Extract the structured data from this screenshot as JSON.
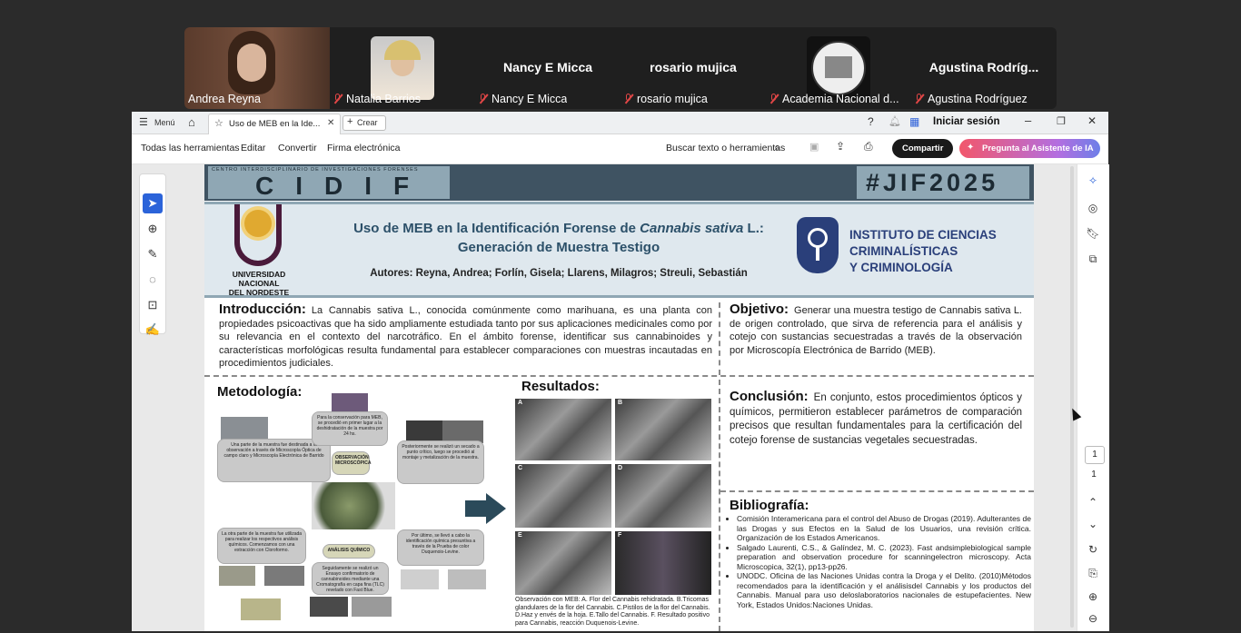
{
  "participants": [
    {
      "name": "Andrea Reyna",
      "big": "",
      "muted": false,
      "video": true
    },
    {
      "name": "Natalia Barrios",
      "big": "",
      "muted": true,
      "video": true
    },
    {
      "name": "Nancy E Micca",
      "big": "Nancy E Micca",
      "muted": true,
      "video": false
    },
    {
      "name": "rosario mujica",
      "big": "rosario mujica",
      "muted": true,
      "video": false
    },
    {
      "name": "Academia Nacional d...",
      "big": "",
      "muted": true,
      "video": false,
      "logo": true
    },
    {
      "name": "Agustina Rodríguez",
      "big": "Agustina  Rodríg...",
      "muted": true,
      "video": false
    }
  ],
  "tabbar": {
    "menu": "Menú",
    "tab_title": "Uso de MEB en la Ide...",
    "create": "Crear",
    "sign_in": "Iniciar sesión"
  },
  "toolbar": {
    "items": [
      "Todas las herramientas",
      "Editar",
      "Convertir",
      "Firma electrónica"
    ],
    "search": "Buscar texto o herramientas",
    "share": "Compartir",
    "ai": "Pregunta al Asistente de IA"
  },
  "pager": {
    "current": "1",
    "total": "1"
  },
  "poster": {
    "banner_left": "CIDIF",
    "banner_left_small": "CENTRO INTERDISCIPLINARIO DE INVESTIGACIONES FORENSES",
    "banner_right": "#JIF2025",
    "title_line1_a": "Uso de MEB en la Identificación Forense de ",
    "title_line1_i": "Cannabis sativa",
    "title_line1_b": " L.:",
    "title_line2": "Generación de Muestra Testigo",
    "authors": "Autores: Reyna, Andrea; Forlín, Gisela; Llarens, Milagros; Streuli, Sebastián",
    "unne": [
      "UNIVERSIDAD",
      "NACIONAL",
      "DEL NORDESTE"
    ],
    "icc": [
      "INSTITUTO DE CIENCIAS",
      "CRIMINALÍSTICAS",
      "Y CRIMINOLOGÍA"
    ],
    "intro_title": "Introducción:",
    "intro_text": "La Cannabis sativa L., conocida comúnmente como marihuana, es una planta con propiedades psicoactivas que ha sido ampliamente estudiada tanto por sus aplicaciones medicinales como por su relevancia en el contexto del narcotráfico. En el ámbito forense, identificar sus cannabinoides y características morfológicas resulta fundamental para establecer comparaciones con muestras incautadas en procedimientos judiciales.",
    "obj_title": "Objetivo:",
    "obj_text": "Generar una muestra testigo de Cannabis sativa L. de origen controlado, que sirva de referencia para el análisis y cotejo con sustancias secuestradas a través de la observación por Microscopía Electrónica de Barrido (MEB).",
    "met_title": "Metodología:",
    "res_title": "Resultados:",
    "flow": {
      "b1": "Una parte de la muestra fue destinada a la observación a través de Microscopía Óptica de campo claro y Microscopía Electrónica de Barrido",
      "b2": "Para la conservación para MEB, se procedió en primer lugar a la deshidratación de la muestra por 24 hs.",
      "b3": "OBSERVACIÓN MICROSCÓPICA",
      "b4": "Posteriormente se realizó un secado a punto crítico, luego se procedió al montaje y metalización de la muestra.",
      "b5": "La otra parte de la muestra fue utilizada para realizar los respectivos análisis químicos. Comenzamos con una extracción con Cloroformo.",
      "b6": "ANÁLISIS QUÍMICO",
      "b7": "Seguidamente se realizó un Ensayo confirmatorio de cannabinoides mediante una Cromatografía en capa fina (TLC) revelado con Fast Blue.",
      "b8": "Por último, se llevó a cabo la identificación química presuntiva a través de la Prueba de color Duquenois-Levine."
    },
    "sem_labels": [
      "A",
      "B",
      "C",
      "D",
      "E",
      "F"
    ],
    "caption": "Observación con MEB: A. Flor del Cannabis rehidratada. B.Tricomas glandulares de la flor del Cannabis. C.Pistilos de la flor del Cannabis. D.Haz y envés de la hoja. E.Tallo del Cannabis. F. Resultado positivo para Cannabis, reacción Duquenois-Levine.",
    "conc_title": "Conclusión:",
    "conc_text": "En conjunto, estos procedimientos ópticos y químicos, permitieron establecer parámetros de comparación precisos que resultan fundamentales para la certificación del cotejo forense de sustancias vegetales secuestradas.",
    "bib_title": "Bibliografía:",
    "bib": [
      "Comisión Interamericana para el control del Abuso de Drogas (2019). Adulterantes de las Drogas y sus Efectos en la Salud de los Usuarios, una revisión crítica. Organización de los Estados Americanos.",
      "Salgado Laurenti, C.S., & Galíndez, M. C. (2023). Fast andsimplebiological sample preparation and observation procedure for scanningelectron microscopy. Acta Microscopica, 32(1), pp13-pp26.",
      "UNODC. Oficina de las Naciones Unidas contra la Droga y el Delito. (2010)Métodos recomendados para la identificación y el análisisdel Cannabis y los productos del Cannabis. Manual para uso deloslaboratorios nacionales de estupefacientes. New York, Estados Unidos:Naciones Unidas."
    ]
  }
}
